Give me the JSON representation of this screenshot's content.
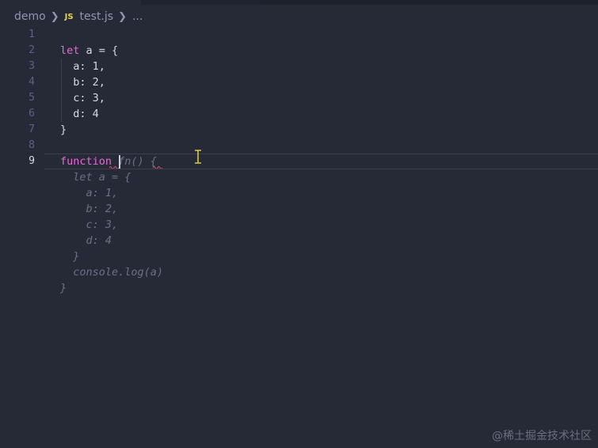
{
  "breadcrumb": {
    "folder": "demo",
    "file_icon": "JS",
    "file": "test.js",
    "ellipsis": "..."
  },
  "editor": {
    "current_line": 9,
    "lines": [
      {
        "num": "1",
        "text": ""
      },
      {
        "num": "2",
        "tokens": [
          "let",
          " a = {"
        ]
      },
      {
        "num": "3",
        "text": "  a: 1,"
      },
      {
        "num": "4",
        "text": "  b: 2,"
      },
      {
        "num": "5",
        "text": "  c: 3,"
      },
      {
        "num": "6",
        "text": "  d: 4"
      },
      {
        "num": "7",
        "text": "}"
      },
      {
        "num": "8",
        "text": ""
      },
      {
        "num": "9",
        "tokens": [
          "function",
          " ",
          "fn() {"
        ]
      }
    ],
    "ghost_suggestion": [
      "  let a = {",
      "    a: 1,",
      "    b: 2,",
      "    c: 3,",
      "    d: 4",
      "  }",
      "  console.log(a)",
      "}"
    ]
  },
  "watermark": "@稀土掘金技术社区",
  "colors": {
    "background": "#262a37",
    "keyword": "#e26bd5",
    "text": "#d4d8e6",
    "ghost": "#6b7088",
    "line_number": "#5b6385",
    "js_icon": "#e8d44d",
    "squiggle": "#e05561",
    "ibeam": "#d8c84a"
  }
}
